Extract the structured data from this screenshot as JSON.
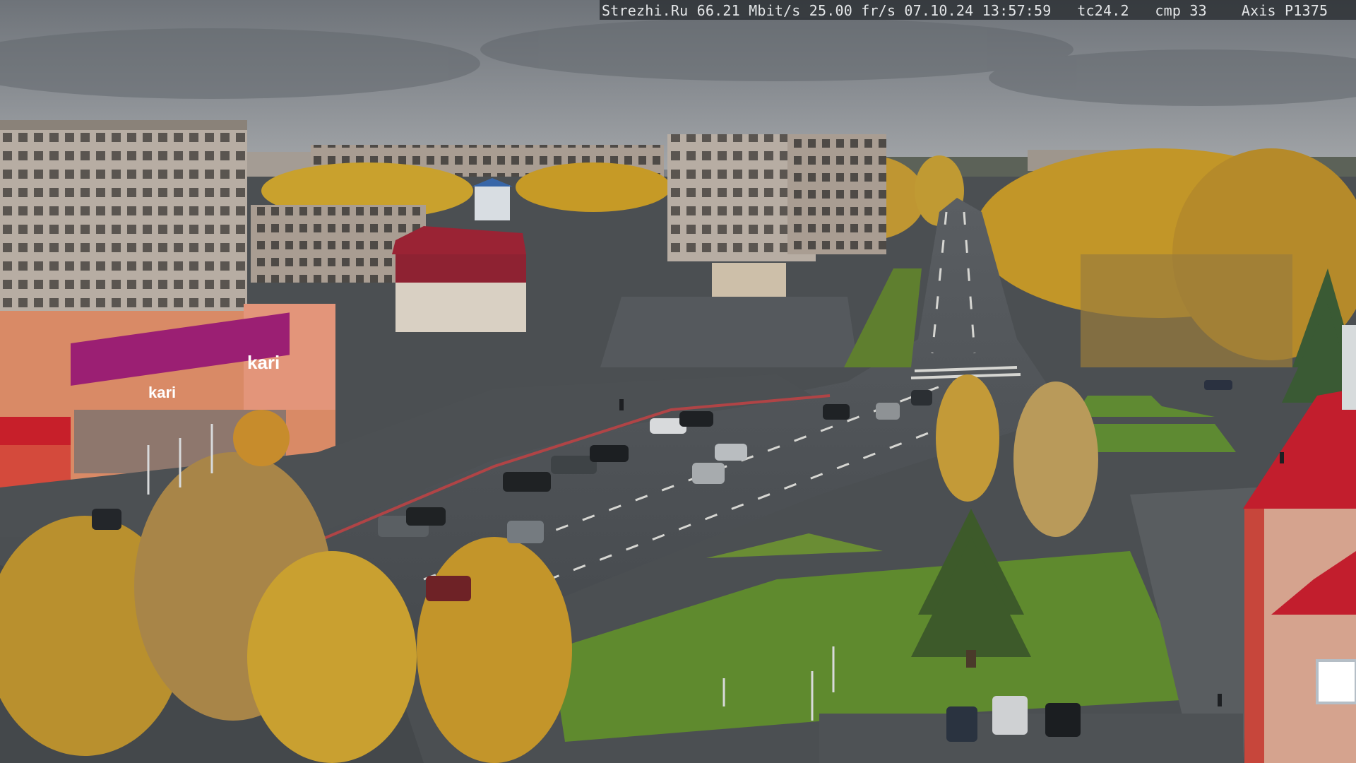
{
  "camera_overlay": {
    "text": "Strezhi.Ru 66.21 Mbit/s 25.00 fr/s 07.10.24 13:57:59   tc24.2   cmp 33    Axis P1375"
  },
  "storefront": {
    "brand_sign": "kari",
    "brand_sign_secondary": "kari"
  },
  "colors": {
    "sky": "#8a8e93",
    "asphalt": "#4e5256",
    "grass": "#5e7c34",
    "autumn_foliage": "#c79a2a",
    "storefront_magenta": "#9b1f73",
    "roof_red": "#b8202e"
  }
}
